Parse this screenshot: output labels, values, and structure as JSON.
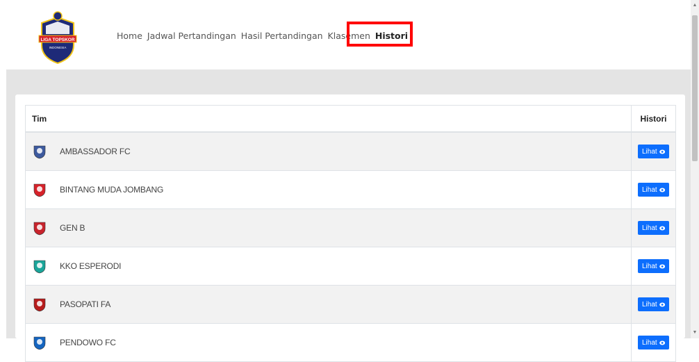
{
  "nav": {
    "items": [
      "Home",
      "Jadwal Pertandingan",
      "Hasil Pertandingan",
      "Klasemen",
      "Histori"
    ],
    "active": "Histori"
  },
  "logo": {
    "text_top": "LIGA TOPSKOR",
    "text_bottom": "INDONESIA"
  },
  "table": {
    "headers": {
      "team": "Tim",
      "history": "Histori"
    },
    "button_label": "Lihat",
    "rows": [
      {
        "name": "AMBASSADOR FC",
        "icon": "ambassador-logo",
        "color": "#3d5a9e"
      },
      {
        "name": "BINTANG MUDA JOMBANG",
        "icon": "bintang-muda-logo",
        "color": "#d6222a"
      },
      {
        "name": "GEN B",
        "icon": "gen-b-logo",
        "color": "#c8232c"
      },
      {
        "name": "KKO ESPERODI",
        "icon": "kko-esperodi-logo",
        "color": "#1aa59a"
      },
      {
        "name": "PASOPATI FA",
        "icon": "pasopati-logo",
        "color": "#b71c1c"
      },
      {
        "name": "PENDOWO FC",
        "icon": "pendowo-logo",
        "color": "#1565c0"
      }
    ]
  },
  "colors": {
    "accent": "#0d6efd",
    "highlight": "#ff0000"
  }
}
